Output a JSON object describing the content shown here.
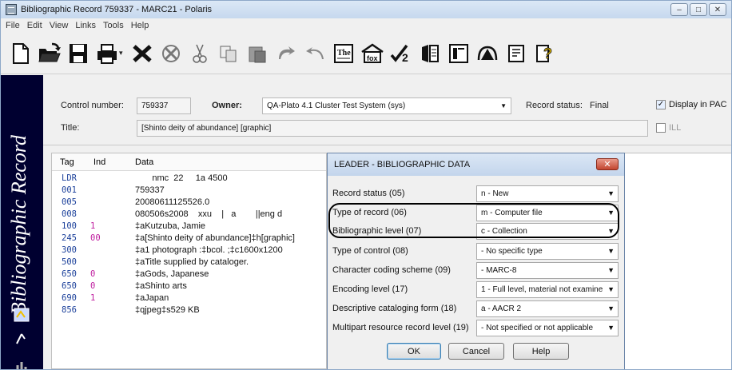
{
  "window": {
    "title": "Bibliographic Record 759337 - MARC21 - Polaris",
    "controls": [
      "–",
      "□",
      "✕"
    ]
  },
  "menu": [
    "File",
    "Edit",
    "View",
    "Links",
    "Tools",
    "Help"
  ],
  "toolbar_icons": [
    "new-doc-icon",
    "open-folder-icon",
    "save-icon",
    "print-icon",
    "delete-icon",
    "cancel-icon",
    "cut-icon",
    "copy-icon",
    "paste-icon",
    "undo-icon",
    "redo-icon",
    "thesaurus-icon",
    "find-icon",
    "authority-icon",
    "record-icon",
    "link-icon",
    "validate-icon",
    "preferences-icon",
    "help-icon"
  ],
  "side_band": {
    "title": "Bibliographic Record"
  },
  "header": {
    "control_number_label": "Control number:",
    "control_number": "759337",
    "owner_label": "Owner:",
    "owner": "QA-Plato 4.1 Cluster Test System (sys)",
    "record_status_label": "Record status:",
    "record_status": "Final",
    "display_in_pac_label": "Display in PAC",
    "display_in_pac": true,
    "title_label": "Title:",
    "title": "[Shinto deity of abundance] [graphic]",
    "ill_label": "ILL",
    "ill": false
  },
  "marc_grid": {
    "columns": [
      "Tag",
      "Ind",
      "Data"
    ],
    "rows": [
      {
        "tag": "LDR",
        "ind": "",
        "data": "       nmc  22     1a 4500"
      },
      {
        "tag": "001",
        "ind": "",
        "data": "759337"
      },
      {
        "tag": "005",
        "ind": "",
        "data": "20080611125526.0"
      },
      {
        "tag": "008",
        "ind": "",
        "data": "080506s2008    xxu    |   a        ||eng d"
      },
      {
        "tag": "100",
        "ind": "1",
        "data": "‡aKutzuba, Jamie"
      },
      {
        "tag": "245",
        "ind": "00",
        "data": "‡a[Shinto deity of abundance]‡h[graphic]"
      },
      {
        "tag": "300",
        "ind": "",
        "data": "‡a1 photograph :‡bcol. ;‡c1600x1200"
      },
      {
        "tag": "500",
        "ind": "",
        "data": "‡aTitle supplied by cataloger."
      },
      {
        "tag": "650",
        "ind": "0",
        "data": "‡aGods, Japanese"
      },
      {
        "tag": "650",
        "ind": "0",
        "data": "‡aShinto arts"
      },
      {
        "tag": "690",
        "ind": "1",
        "data": "‡aJapan"
      },
      {
        "tag": "856",
        "ind": "",
        "data": "‡qjpeg‡s529 KB"
      }
    ]
  },
  "leader_dialog": {
    "title": "LEADER - BIBLIOGRAPHIC DATA",
    "close_label": "✕",
    "fields": [
      {
        "label": "Record status (05)",
        "value": "n - New"
      },
      {
        "label": "Type of record (06)",
        "value": "m - Computer file"
      },
      {
        "label": "Bibliographic level (07)",
        "value": "c - Collection"
      },
      {
        "label": "Type of control (08)",
        "value": "- No specific type"
      },
      {
        "label": "Character coding scheme (09)",
        "value": "- MARC-8"
      },
      {
        "label": "Encoding level (17)",
        "value": "1 - Full level, material not examine"
      },
      {
        "label": "Descriptive cataloging form (18)",
        "value": "a - AACR 2"
      },
      {
        "label": "Multipart resource record level (19)",
        "value": "- Not specified or not applicable"
      }
    ],
    "ok_label": "OK",
    "cancel_label": "Cancel",
    "help_label": "Help"
  }
}
